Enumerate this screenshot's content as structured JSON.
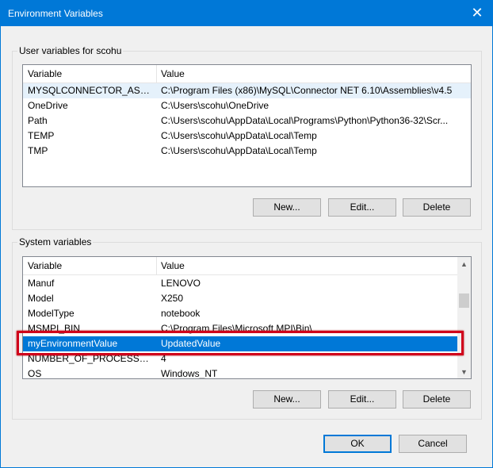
{
  "window": {
    "title": "Environment Variables",
    "close_glyph": "✕"
  },
  "user_vars": {
    "group_label": "User variables for scohu",
    "col_variable": "Variable",
    "col_value": "Value",
    "rows": [
      {
        "variable": "MYSQLCONNECTOR_ASSE...",
        "value": "C:\\Program Files (x86)\\MySQL\\Connector NET 6.10\\Assemblies\\v4.5"
      },
      {
        "variable": "OneDrive",
        "value": "C:\\Users\\scohu\\OneDrive"
      },
      {
        "variable": "Path",
        "value": "C:\\Users\\scohu\\AppData\\Local\\Programs\\Python\\Python36-32\\Scr..."
      },
      {
        "variable": "TEMP",
        "value": "C:\\Users\\scohu\\AppData\\Local\\Temp"
      },
      {
        "variable": "TMP",
        "value": "C:\\Users\\scohu\\AppData\\Local\\Temp"
      }
    ],
    "new_label": "New...",
    "edit_label": "Edit...",
    "delete_label": "Delete"
  },
  "system_vars": {
    "group_label": "System variables",
    "col_variable": "Variable",
    "col_value": "Value",
    "rows": [
      {
        "variable": "Manuf",
        "value": "LENOVO"
      },
      {
        "variable": "Model",
        "value": "X250"
      },
      {
        "variable": "ModelType",
        "value": "notebook"
      },
      {
        "variable": "MSMPI_BIN",
        "value": "C:\\Program Files\\Microsoft MPI\\Bin\\"
      },
      {
        "variable": "myEnvironmentValue",
        "value": "UpdatedValue"
      },
      {
        "variable": "NUMBER_OF_PROCESSORS",
        "value": "4"
      },
      {
        "variable": "OS",
        "value": "Windows_NT"
      }
    ],
    "new_label": "New...",
    "edit_label": "Edit...",
    "delete_label": "Delete"
  },
  "footer": {
    "ok_label": "OK",
    "cancel_label": "Cancel"
  },
  "colors": {
    "titlebar": "#0078d7",
    "selection": "#0078d7",
    "highlight_box": "#d0021b"
  }
}
